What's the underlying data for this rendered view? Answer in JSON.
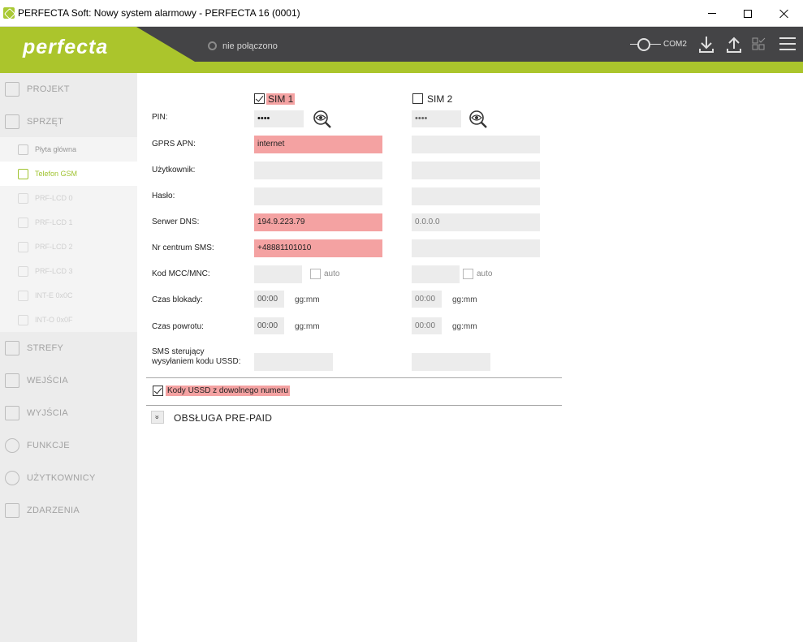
{
  "window": {
    "title": "PERFECTA Soft: Nowy system alarmowy - PERFECTA 16  (0001)"
  },
  "header": {
    "logo": "perfecta",
    "connection_status": "nie połączono",
    "port": "COM2"
  },
  "sidebar": {
    "items": [
      {
        "label": "PROJEKT"
      },
      {
        "label": "SPRZĘT"
      },
      {
        "label": "STREFY"
      },
      {
        "label": "WEJŚCIA"
      },
      {
        "label": "WYJŚCIA"
      },
      {
        "label": "FUNKCJE"
      },
      {
        "label": "UŻYTKOWNICY"
      },
      {
        "label": "ZDARZENIA"
      }
    ],
    "subitems": [
      {
        "label": "Płyta główna"
      },
      {
        "label": "Telefon GSM"
      },
      {
        "label": "PRF-LCD 0"
      },
      {
        "label": "PRF-LCD 1"
      },
      {
        "label": "PRF-LCD 2"
      },
      {
        "label": "PRF-LCD 3"
      },
      {
        "label": "INT-E 0x0C"
      },
      {
        "label": "INT-O 0x0F"
      }
    ],
    "active_subitem": "Telefon GSM"
  },
  "form": {
    "labels": {
      "pin": "PIN:",
      "apn": "GPRS APN:",
      "user": "Użytkownik:",
      "password": "Hasło:",
      "dns": "Serwer DNS:",
      "sms_center": "Nr centrum SMS:",
      "mcc": "Kod MCC/MNC:",
      "block_time": "Czas blokady:",
      "return_time": "Czas powrotu:",
      "ussd_line1": "SMS sterujący",
      "ussd_line2": "wysyłaniem kodu USSD:"
    },
    "sim1": {
      "label": "SIM 1",
      "enabled": true,
      "pin": "••••",
      "apn": "internet",
      "user": "",
      "password": "",
      "dns": "194.9.223.79",
      "sms_center": "+48881101010",
      "mcc": "",
      "auto_label": "auto",
      "block_time": "00:00",
      "return_time": "00:00",
      "time_unit": "gg:mm",
      "ussd_sms": ""
    },
    "sim2": {
      "label": "SIM 2",
      "enabled": false,
      "pin": "••••",
      "apn": "",
      "user": "",
      "password": "",
      "dns": "0.0.0.0",
      "sms_center": "",
      "mcc": "",
      "auto_label": "auto",
      "block_time": "00:00",
      "return_time": "00:00",
      "time_unit": "gg:mm",
      "ussd_sms": ""
    },
    "ussd_any_number": {
      "label": "Kody USSD z dowolnego numeru",
      "checked": true
    },
    "prepaid": {
      "expand_glyph": "»",
      "title": "OBSŁUGA PRE-PAID"
    }
  },
  "colors": {
    "accent": "#abc52c",
    "header_bg": "#444446",
    "highlight": "#f4a2a2"
  }
}
